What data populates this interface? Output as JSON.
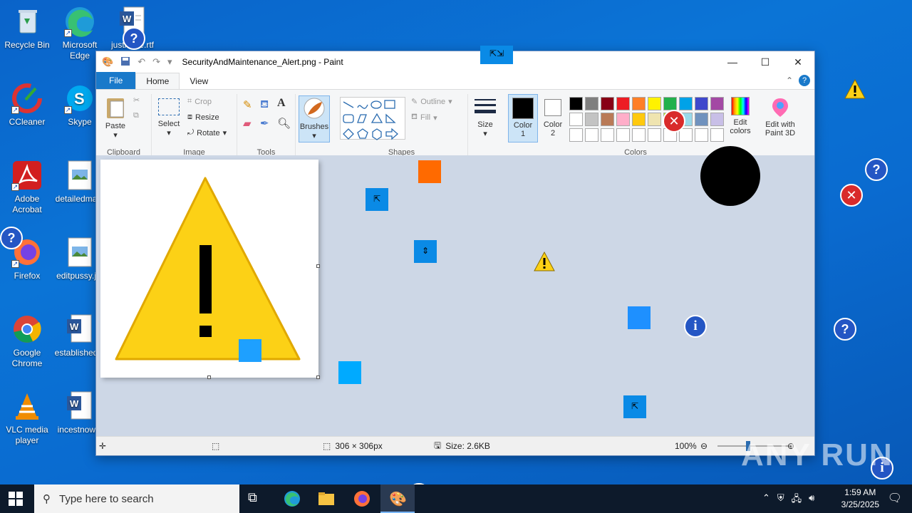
{
  "desktop": {
    "icons": [
      {
        "label": "Recycle Bin"
      },
      {
        "label": "Microsoft Edge"
      },
      {
        "label": "justmore.rtf"
      },
      {
        "label": "CCleaner"
      },
      {
        "label": "Skype"
      },
      {
        "label": "Adobe Acrobat"
      },
      {
        "label": "detailedma..."
      },
      {
        "label": "Firefox"
      },
      {
        "label": "editpussy.j..."
      },
      {
        "label": "Google Chrome"
      },
      {
        "label": "established..."
      },
      {
        "label": "VLC media player"
      },
      {
        "label": "incestnow..."
      }
    ]
  },
  "paint": {
    "title": "SecurityAndMaintenance_Alert.png - Paint",
    "menu": {
      "file": "File",
      "home": "Home",
      "view": "View"
    },
    "ribbon": {
      "clipboard": {
        "paste": "Paste",
        "group": "Clipboard"
      },
      "image": {
        "select": "Select",
        "crop": "Crop",
        "resize": "Resize",
        "rotate": "Rotate",
        "group": "Image"
      },
      "tools": {
        "group": "Tools"
      },
      "brushes": {
        "label": "Brushes"
      },
      "shapes": {
        "outline": "Outline",
        "fill": "Fill",
        "group": "Shapes"
      },
      "size": {
        "label": "Size"
      },
      "color1": {
        "label": "Color 1"
      },
      "color2": {
        "label": "Color 2"
      },
      "colors": {
        "group": "Colors",
        "edit": "Edit colors",
        "paint3d": "Edit with Paint 3D"
      },
      "palette": [
        "#000000",
        "#7f7f7f",
        "#880015",
        "#ed1c24",
        "#ff7f27",
        "#fff200",
        "#22b14c",
        "#00a2e8",
        "#3f48cc",
        "#a349a4",
        "#ffffff",
        "#c3c3c3",
        "#b97a57",
        "#ffaec9",
        "#ffc90e",
        "#efe4b0",
        "#b5e61d",
        "#99d9ea",
        "#7092be",
        "#c8bfe7"
      ]
    },
    "status": {
      "dimensions": "306 × 306px",
      "size": "Size: 2.6KB",
      "zoom": "100%"
    }
  },
  "taskbar": {
    "search_placeholder": "Type here to search",
    "time": "1:59 AM",
    "date": "3/25/2025"
  },
  "watermark": "ANY RUN"
}
